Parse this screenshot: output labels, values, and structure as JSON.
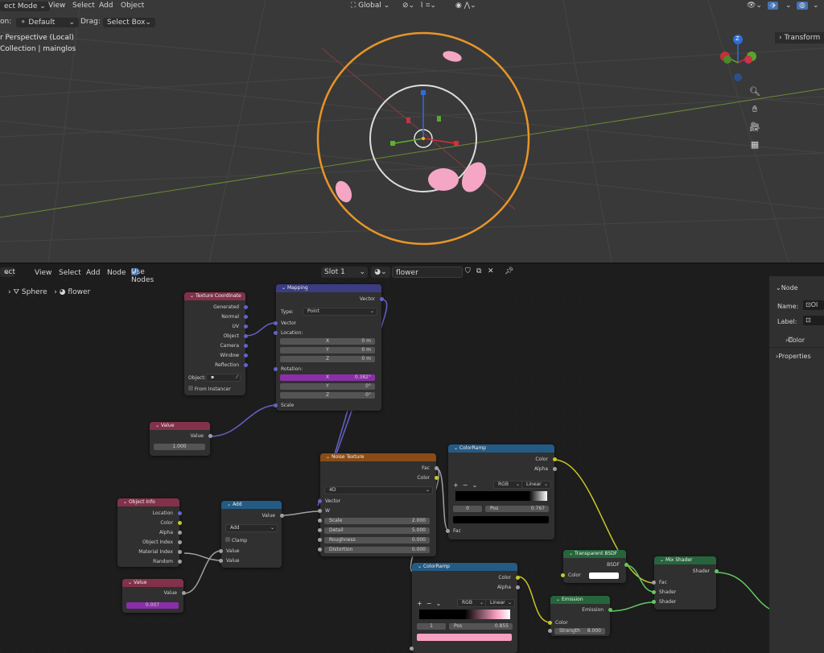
{
  "viewport": {
    "mode": "ect Mode",
    "menu": [
      "View",
      "Select",
      "Add",
      "Object"
    ],
    "orientation_label": "on:",
    "orientation_value": "Default",
    "drag_label": "Drag:",
    "drag_value": "Select Box",
    "transform_space": "Global",
    "view_name": "r Perspective (Local)",
    "collection": "Collection | mainglos",
    "transform_panel": "Transform",
    "gizmo_axis": "Z"
  },
  "node_editor": {
    "editor_type": "ect",
    "menu": [
      "View",
      "Select",
      "Add",
      "Node"
    ],
    "use_nodes": "Use Nodes",
    "slot": "Slot 1",
    "material": "flower",
    "breadcrumb_object": "Sphere",
    "breadcrumb_material": "flower"
  },
  "sidebar": {
    "section": "Node",
    "name_label": "Name:",
    "name_value": "Ol",
    "label_label": "Label:",
    "color": "Color",
    "properties": "Properties"
  },
  "nodes": {
    "texcoord": {
      "title": "Texture Coordinate",
      "outputs": [
        "Generated",
        "Normal",
        "UV",
        "Object",
        "Camera",
        "Window",
        "Reflection"
      ],
      "object_label": "Object:",
      "from_instancer": "From Instancer"
    },
    "mapping": {
      "title": "Mapping",
      "out_vector": "Vector",
      "type_label": "Type:",
      "type_value": "Point",
      "in_vector": "Vector",
      "location": "Location:",
      "loc": [
        {
          "a": "X",
          "v": "0 m"
        },
        {
          "a": "Y",
          "v": "0 m"
        },
        {
          "a": "Z",
          "v": "0 m"
        }
      ],
      "rotation": "Rotation:",
      "rot": [
        {
          "a": "X",
          "v": "0.382°"
        },
        {
          "a": "Y",
          "v": "0°"
        },
        {
          "a": "Z",
          "v": "0°"
        }
      ],
      "scale": "Scale"
    },
    "value1": {
      "title": "Value",
      "out": "Value",
      "value": "1.000"
    },
    "noise": {
      "title": "Noise Texture",
      "out_fac": "Fac",
      "out_color": "Color",
      "dim": "4D",
      "vector": "Vector",
      "w": "W",
      "fields": [
        {
          "l": "Scale",
          "v": "2.000"
        },
        {
          "l": "Detail",
          "v": "5.000"
        },
        {
          "l": "Roughness",
          "v": "0.000"
        },
        {
          "l": "Distortion",
          "v": "0.000"
        }
      ]
    },
    "ramp1": {
      "title": "ColorRamp",
      "out_color": "Color",
      "out_alpha": "Alpha",
      "mode": "RGB",
      "interp": "Linear",
      "index": "0",
      "pos_label": "Pos",
      "pos_value": "0.767",
      "in_fac": "Fac"
    },
    "objinfo": {
      "title": "Object Info",
      "outputs": [
        "Location",
        "Color",
        "Alpha",
        "Object Index",
        "Material Index",
        "Random"
      ]
    },
    "add": {
      "title": "Add",
      "out": "Value",
      "op": "Add",
      "clamp": "Clamp",
      "in1": "Value",
      "in2": "Value"
    },
    "value2": {
      "title": "Value",
      "out": "Value",
      "value": "0.007"
    },
    "ramp2": {
      "title": "ColorRamp",
      "out_color": "Color",
      "out_alpha": "Alpha",
      "mode": "RGB",
      "interp": "Linear",
      "index": "1",
      "pos_label": "Pos",
      "pos_value": "0.855"
    },
    "transparent": {
      "title": "Transparent BSDF",
      "out": "BSDF",
      "in_color": "Color"
    },
    "emission": {
      "title": "Emission",
      "out": "Emission",
      "in_color": "Color",
      "strength_label": "Strength",
      "strength_value": "8.000"
    },
    "mix": {
      "title": "Mix Shader",
      "out": "Shader",
      "in_fac": "Fac",
      "in_s1": "Shader",
      "in_s2": "Shader"
    }
  },
  "colors": {
    "accent": "#4772b3",
    "orange_outline": "#e89528",
    "pink": "#f8a0c0",
    "purple_field": "#8a2fa8"
  }
}
